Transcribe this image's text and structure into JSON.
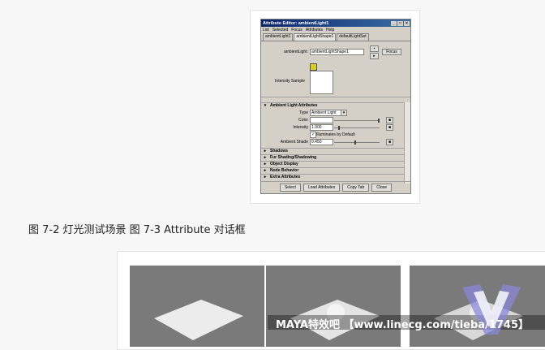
{
  "attribute_editor": {
    "title": "Attribute Editor: ambientLight1",
    "window_controls": [
      "_",
      "□",
      "×"
    ],
    "menu": [
      "List",
      "Selected",
      "Focus",
      "Attributes",
      "Help"
    ],
    "tabs": [
      "ambientLight1",
      "ambientLightShape1",
      "defaultLightSet"
    ],
    "node_label": "ambientLight:",
    "node_value": "ambientLightShape1",
    "focus_button": "Focus",
    "intensity_sample_label": "Intensity Sample",
    "section_title": "Ambient Light Attributes",
    "type_label": "Type",
    "type_value": "Ambient Light",
    "color_label": "Color",
    "intensity_label": "Intensity",
    "intensity_value": "1.000",
    "illuminates_label": "Illuminates by Default",
    "ambient_shade_label": "Ambient Shade",
    "ambient_shade_value": "0.450",
    "collapsed_sections": [
      "Shadows",
      "Fur Shading/Shadowing",
      "Object Display",
      "Node Behavior",
      "Extra Attributes"
    ],
    "buttons": [
      "Select",
      "Load Attributes",
      "Copy Tab",
      "Close"
    ]
  },
  "caption": "图 7-2 灯光测试场景 图 7-3 Attribute 对话框",
  "watermark": "MAYA特效吧 【www.linecg.com/tieba/1745】"
}
